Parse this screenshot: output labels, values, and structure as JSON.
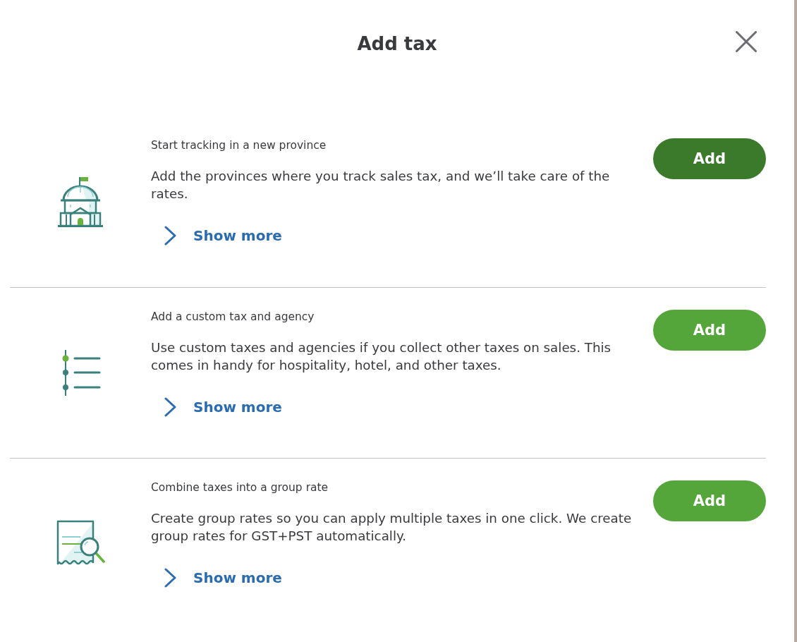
{
  "dialog": {
    "title": "Add tax"
  },
  "options": [
    {
      "kind": "building",
      "heading": "Start tracking in a new province",
      "description": "Add the provinces where you track sales tax, and we’ll take care of the rates.",
      "show_more": {
        "label": "Show more",
        "expanded": false
      },
      "button": {
        "label": "Add",
        "hovered": true
      }
    },
    {
      "kind": "list",
      "heading": "Add a custom tax and agency",
      "description": "Use custom taxes and agencies if you collect other taxes on sales. This comes in handy for hospitality, hotel, and other taxes.",
      "show_more": {
        "label": "Show more",
        "expanded": false
      },
      "button": {
        "label": "Add",
        "hovered": false
      }
    },
    {
      "kind": "receipt",
      "heading": "Combine taxes into a group rate",
      "description": "Create group rates so you can apply multiple taxes in one click. We create group rates for GST+PST automatically.",
      "show_more": {
        "label": "Show more",
        "expanded": false
      },
      "button": {
        "label": "Add",
        "hovered": false
      }
    }
  ]
}
